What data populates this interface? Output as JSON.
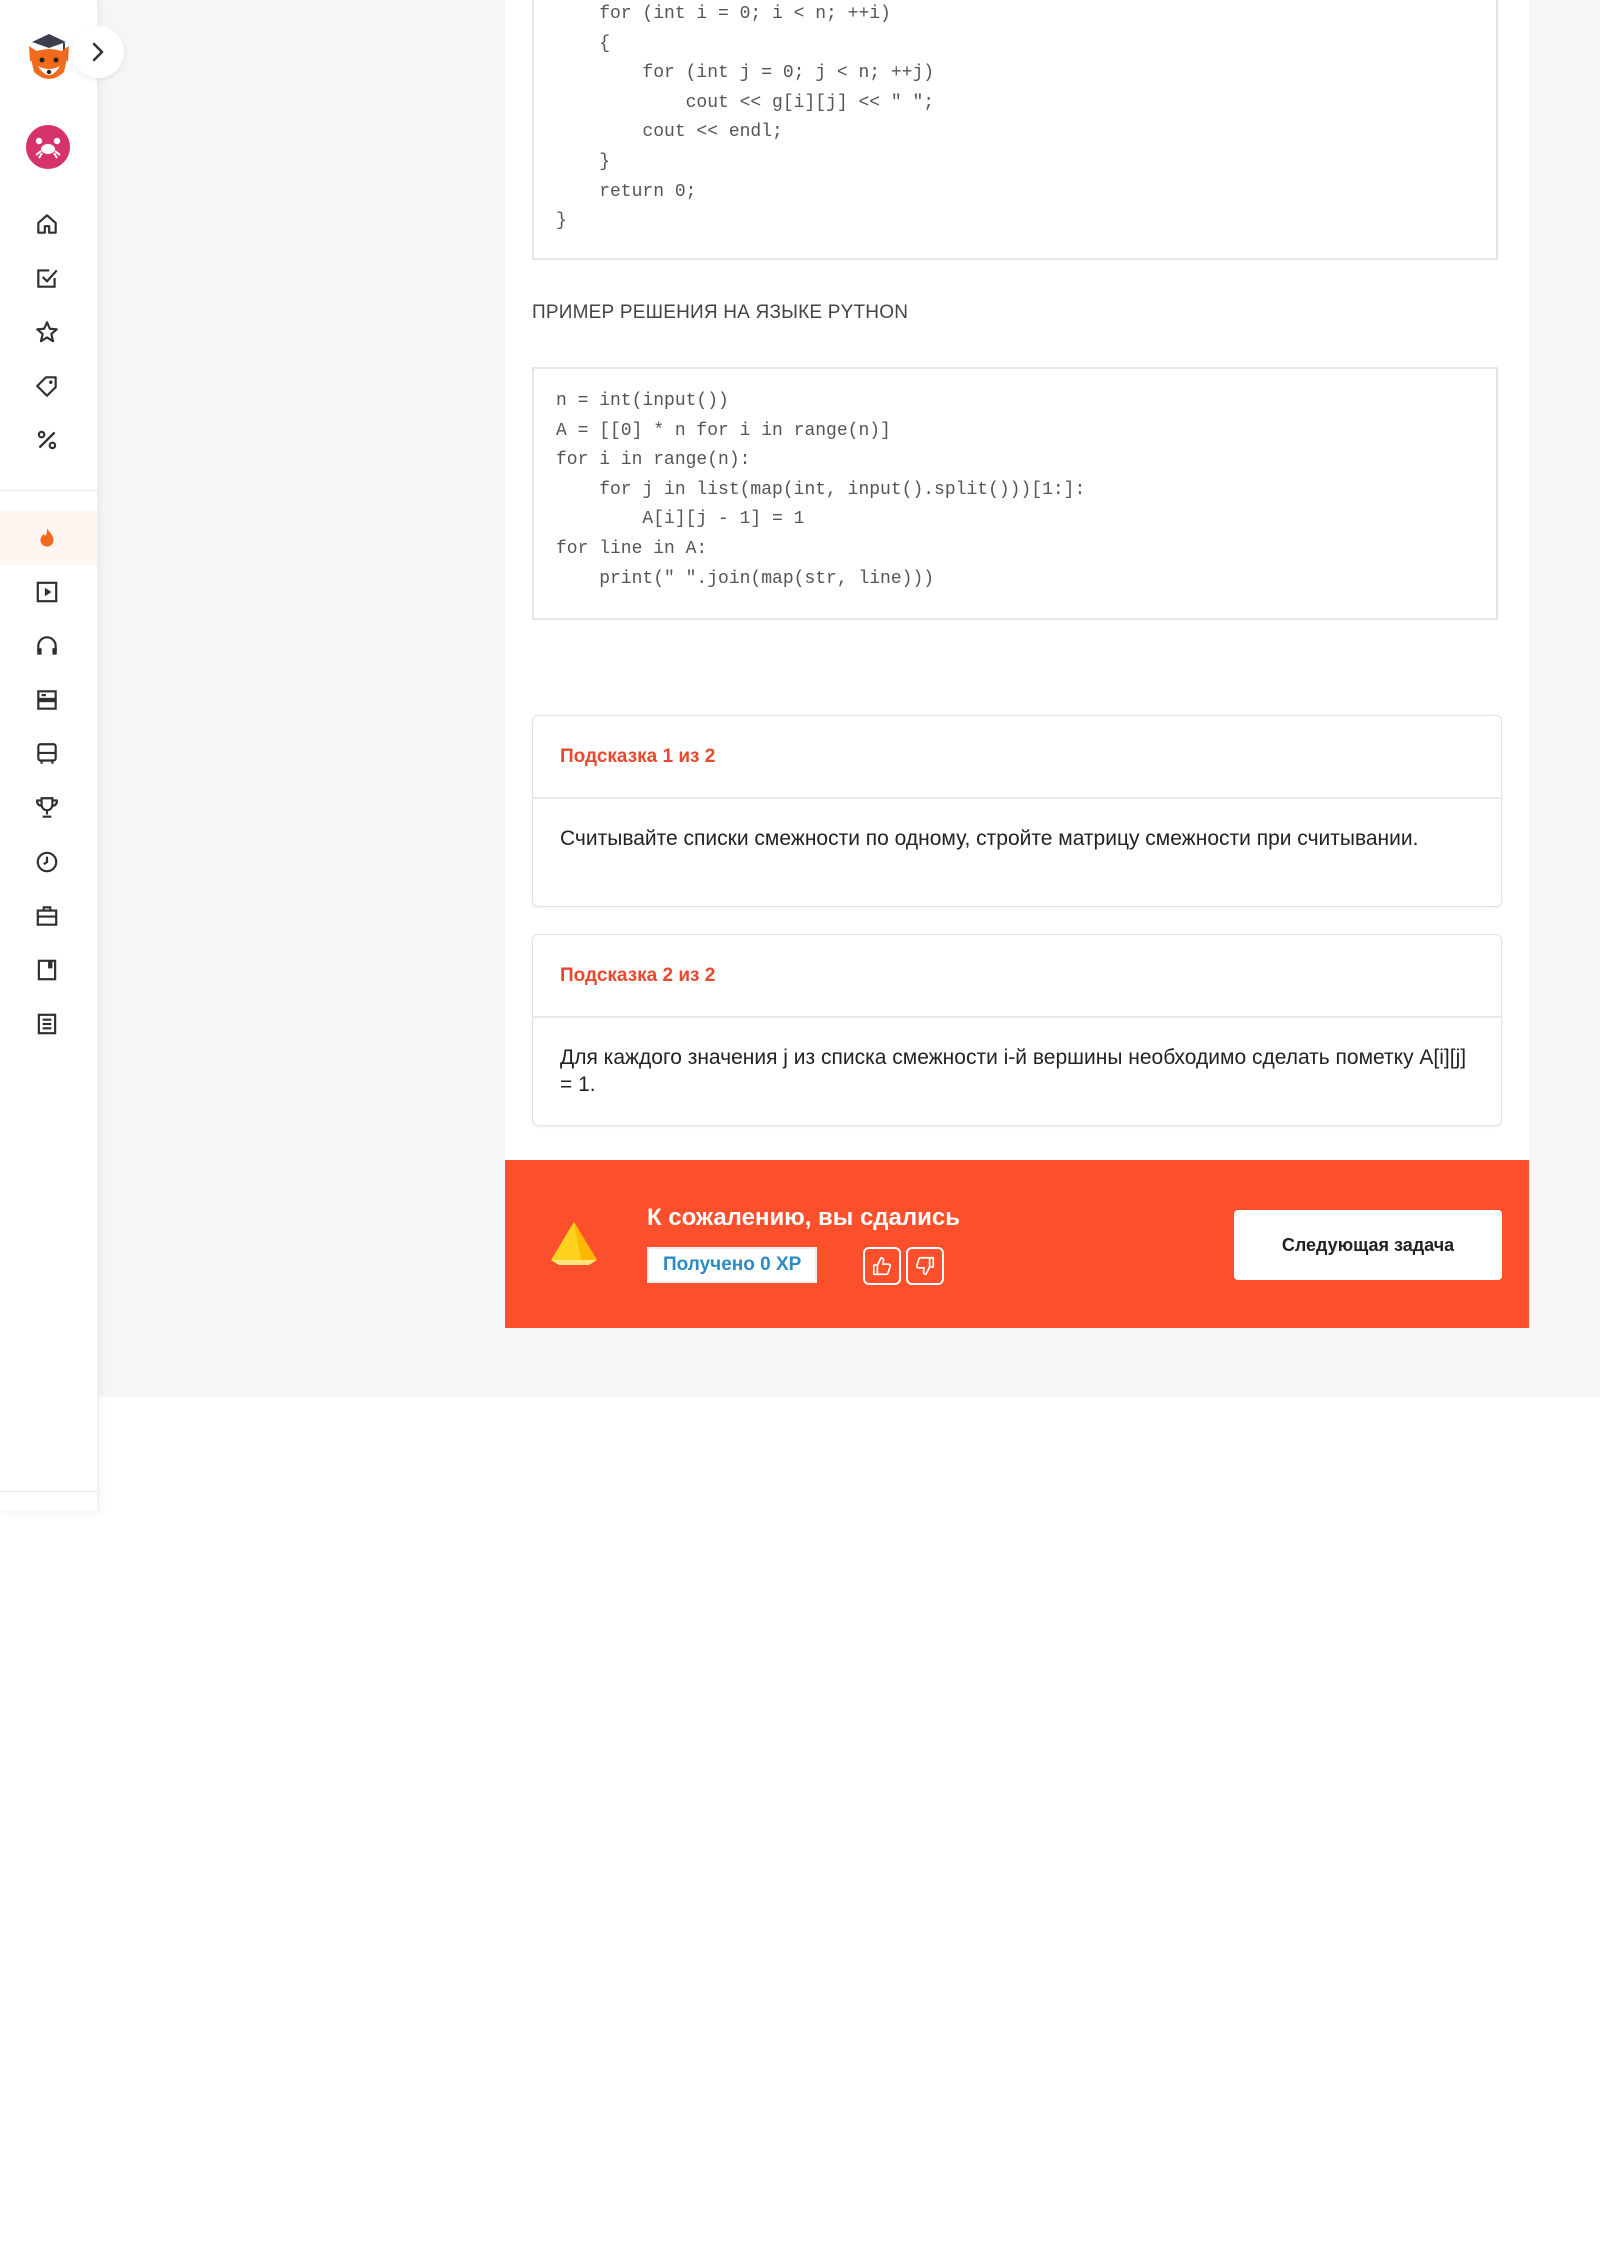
{
  "code_cpp_tail": {
    "lines": [
      "    for (int i = 0; i < n; ++i)",
      "    {",
      "        for (int j = 0; j < n; ++j)",
      "            cout << g[i][j] << \" \";",
      "        cout << endl;",
      "    }",
      "    return 0;",
      "}"
    ]
  },
  "python_section": {
    "heading": "ПРИМЕР РЕШЕНИЯ НА ЯЗЫКЕ PYTHON",
    "lines": [
      "n = int(input())",
      "A = [[0] * n for i in range(n)]",
      "for i in range(n):",
      "    for j in list(map(int, input().split()))[1:]:",
      "        A[i][j - 1] = 1",
      "for line in A:",
      "    print(\" \".join(map(str, line)))"
    ]
  },
  "hints": [
    {
      "title": "Подсказка 1 из 2",
      "text": "Считывайте списки смежности по одному, стройте матрицу смежности при считывании."
    },
    {
      "title": "Подсказка 2 из 2",
      "text": "Для каждого значения j из списка смежности i-й вершины необходимо сделать пометку A[i][j] = 1."
    }
  ],
  "banner": {
    "title": "К сожалению, вы сдались",
    "xp_label": "Получено 0 XP",
    "next_button": "Следующая задача",
    "color": "#fc4f2c"
  },
  "sidebar": {
    "icons": [
      "home-icon",
      "checkbox-icon",
      "star-icon",
      "tag-icon",
      "percent-icon",
      "flame-icon",
      "play-icon",
      "headphones-icon",
      "server-icon",
      "bus-icon",
      "trophy-icon",
      "clock-icon",
      "briefcase-icon",
      "book-icon",
      "list-icon"
    ],
    "accent": "#f26b1d"
  }
}
